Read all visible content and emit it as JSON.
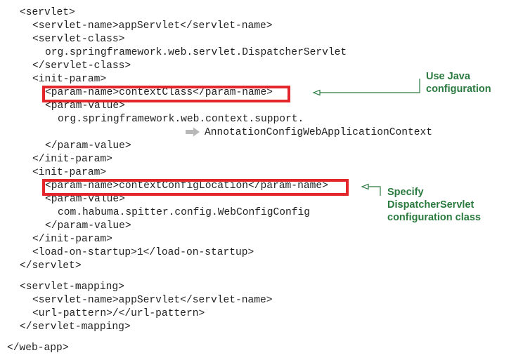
{
  "code_lines": [
    "<servlet>",
    "<servlet-name>appServlet</servlet-name>",
    "<servlet-class>",
    "org.springframework.web.servlet.DispatcherServlet",
    "</servlet-class>",
    "<init-param>",
    "<param-name>contextClass</param-name>",
    "<param-value>",
    "org.springframework.web.context.support.",
    "AnnotationConfigWebApplicationContext",
    "</param-value>",
    "</init-param>",
    "<init-param>",
    "<param-name>contextConfigLocation</param-name>",
    "<param-value>",
    "com.habuma.spitter.config.WebConfigConfig",
    "</param-value>",
    "</init-param>",
    "<load-on-startup>1</load-on-startup>",
    "</servlet>",
    "<servlet-mapping>",
    "<servlet-name>appServlet</servlet-name>",
    "<url-pattern>/</url-pattern>",
    "</servlet-mapping>",
    "</web-app>"
  ],
  "annotations": [
    {
      "text": "Use Java\nconfiguration",
      "color": "#2a7a3f"
    },
    {
      "text": "Specify\nDispatcherServlet\nconfiguration class",
      "color": "#2a7a3f"
    }
  ],
  "highlight_color": "#e3262b",
  "continuation_icon": "line-continuation-arrow-icon"
}
